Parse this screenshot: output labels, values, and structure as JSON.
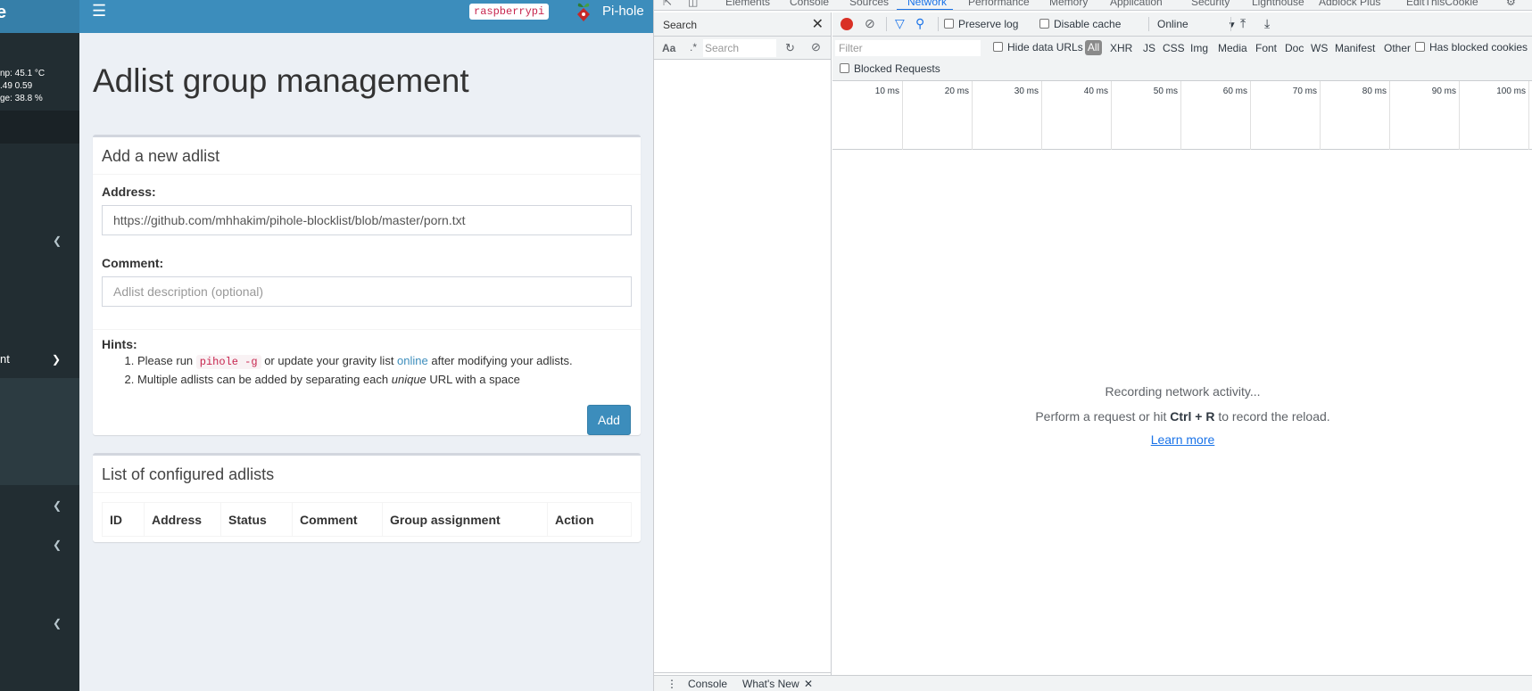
{
  "sidebar": {
    "logo_fragment": "e",
    "stats": [
      "np: 45.1 °C",
      ".49  0.59",
      "ge: 38.8 %"
    ],
    "nav_fragment": "nt"
  },
  "topbar": {
    "hostname": "raspberrypi",
    "brand": "Pi-hole"
  },
  "page": {
    "title": "Adlist group management"
  },
  "add_box": {
    "header": "Add a new adlist",
    "address_label": "Address:",
    "address_value": "https://github.com/mhhakim/pihole-blocklist/blob/master/porn.txt",
    "comment_label": "Comment:",
    "comment_placeholder": "Adlist description (optional)",
    "hints_label": "Hints:",
    "hint1_pre": "Please run ",
    "hint1_code": "pihole -g",
    "hint1_mid": " or update your gravity list ",
    "hint1_link": "online",
    "hint1_post": " after modifying your adlists.",
    "hint2_pre": "Multiple adlists can be added by separating each ",
    "hint2_em": "unique",
    "hint2_post": " URL with a space",
    "add_button": "Add"
  },
  "list_box": {
    "header": "List of configured adlists",
    "columns": [
      "ID",
      "Address",
      "Status",
      "Comment",
      "Group assignment",
      "Action"
    ]
  },
  "devtools": {
    "tabs": [
      "Elements",
      "Console",
      "Sources",
      "Network",
      "Performance",
      "Memory",
      "Application",
      "Security",
      "Lighthouse",
      "Adblock Plus",
      "EditThisCookie"
    ],
    "active_tab": "Network",
    "search_panel": {
      "title": "Search",
      "case_label": "Aa",
      "regex_label": ".*",
      "placeholder": "Search"
    },
    "toolbar": {
      "preserve_log": "Preserve log",
      "disable_cache": "Disable cache",
      "throttle": "Online"
    },
    "filter": {
      "placeholder": "Filter",
      "hide_data_urls": "Hide data URLs",
      "types": [
        "All",
        "XHR",
        "JS",
        "CSS",
        "Img",
        "Media",
        "Font",
        "Doc",
        "WS",
        "Manifest",
        "Other"
      ],
      "has_blocked_cookies": "Has blocked cookies",
      "blocked_requests": "Blocked Requests"
    },
    "timeline_ticks": [
      "10 ms",
      "20 ms",
      "30 ms",
      "40 ms",
      "50 ms",
      "60 ms",
      "70 ms",
      "80 ms",
      "90 ms",
      "100 ms"
    ],
    "empty": {
      "line1": "Recording network activity...",
      "line2_pre": "Perform a request or hit ",
      "line2_keys": "Ctrl + R",
      "line2_post": " to record the reload.",
      "learn_more": "Learn more"
    },
    "drawer": {
      "console": "Console",
      "whats_new": "What's New"
    }
  }
}
